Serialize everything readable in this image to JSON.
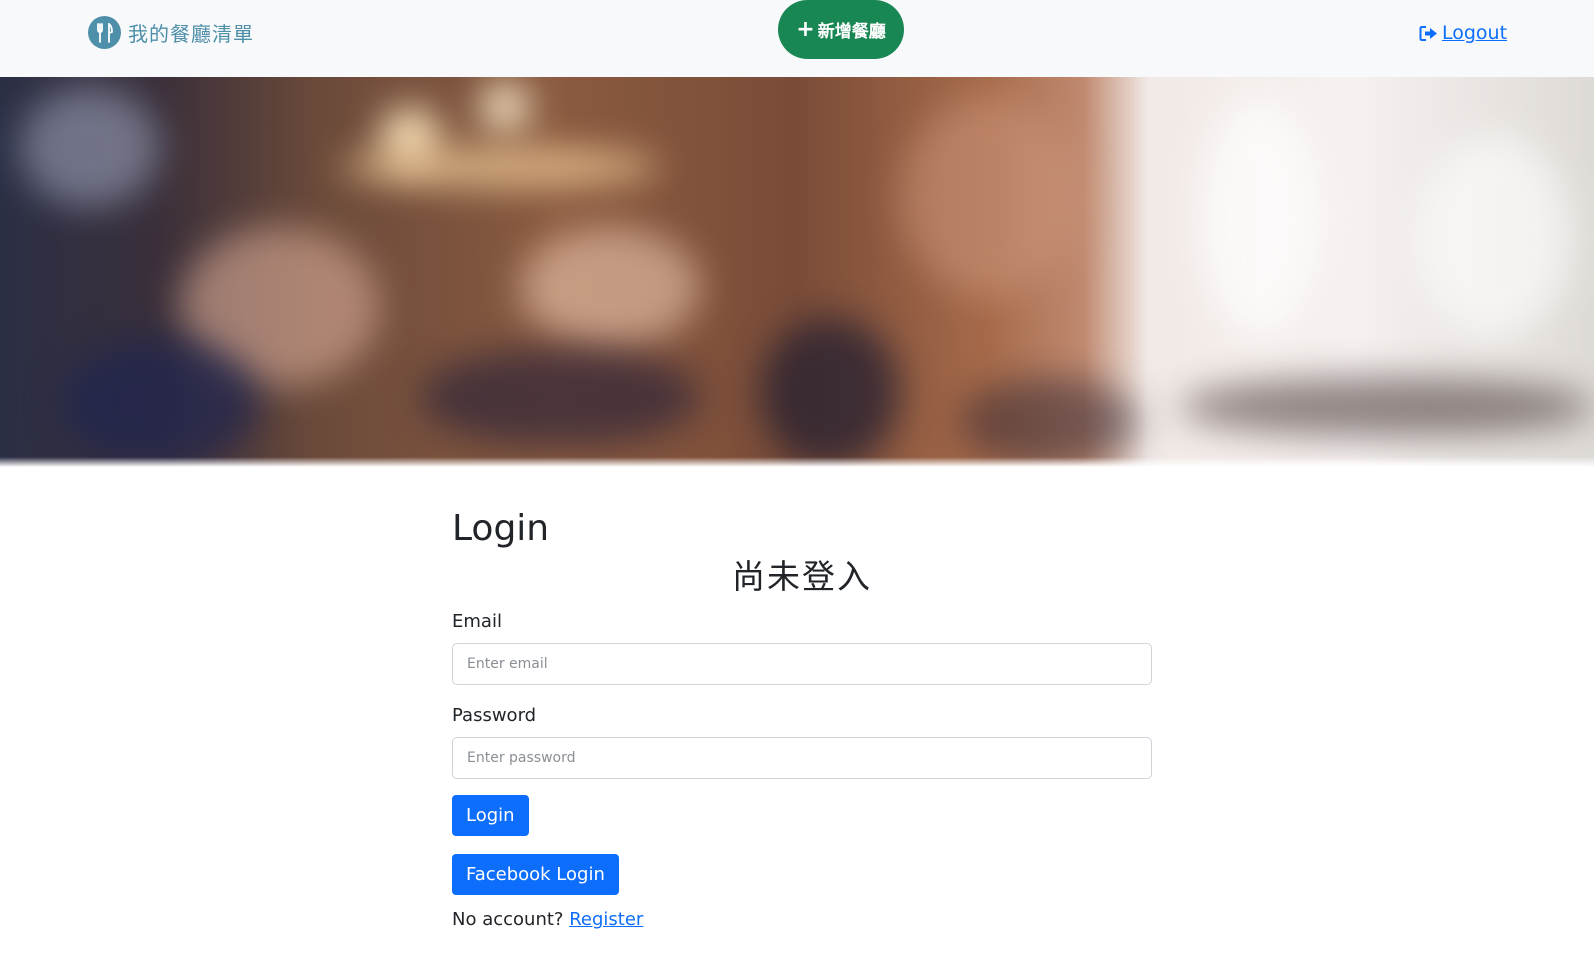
{
  "navbar": {
    "brand_title": "我的餐廳清單",
    "add_button_label": "新增餐廳",
    "logout_label": "Logout"
  },
  "colors": {
    "navbar_bg": "#f8f9fa",
    "brand": "#4e8fa9",
    "add_button": "#198754",
    "primary": "#0d6efd"
  },
  "main": {
    "title": "Login",
    "status": "尚未登入",
    "email_label": "Email",
    "email_placeholder": "Enter email",
    "password_label": "Password",
    "password_placeholder": "Enter password",
    "login_button": "Login",
    "facebook_button": "Facebook Login",
    "no_account_text": "No account?",
    "register_link": "Register"
  }
}
